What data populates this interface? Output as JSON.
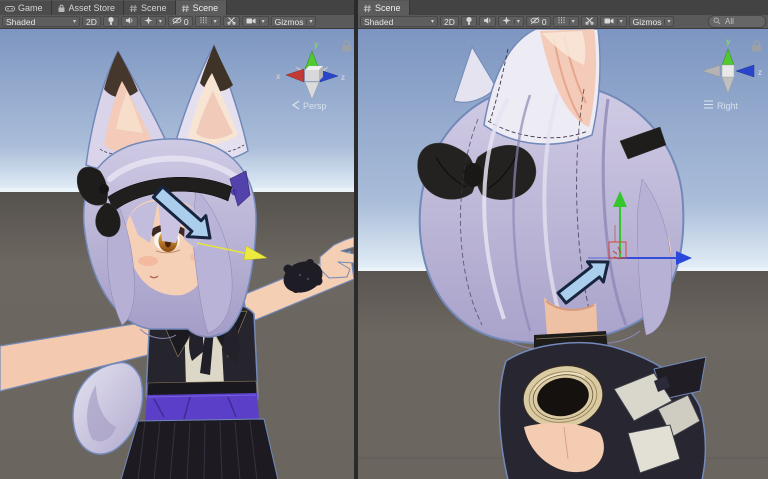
{
  "left_dock": {
    "tabs": [
      {
        "label": "Game",
        "icon": "game-icon"
      },
      {
        "label": "Asset Store",
        "icon": "asset-store-icon"
      },
      {
        "label": "Scene",
        "icon": "scene-icon"
      },
      {
        "label": "Scene",
        "icon": "scene-icon",
        "active": true
      }
    ]
  },
  "right_dock": {
    "tabs": [
      {
        "label": "Scene",
        "icon": "scene-icon",
        "active": true
      }
    ]
  },
  "toolbar": {
    "shading_mode": "Shaded",
    "two_d_label": "2D",
    "hidden_count": "0",
    "gizmos_label": "Gizmos",
    "search_placeholder": "All"
  },
  "left_view": {
    "axis_x": "x",
    "axis_y": "y",
    "axis_z": "z",
    "projection_label": "Persp"
  },
  "right_view": {
    "axis_y": "y",
    "axis_z": "z",
    "projection_label": "Right"
  },
  "colors": {
    "selection_outline": "#7289b9",
    "annotation_arrow_fill": "#abceec",
    "annotation_arrow_outline": "#17253f",
    "gaze_arrow": "#ece93e",
    "gizmo_axis_x": "#c23a34",
    "gizmo_axis_y": "#52c932",
    "gizmo_axis_z": "#2b44cc",
    "sky_top": "#7d96c1",
    "ground": "#6b6560",
    "hair": "#b9b2d6"
  }
}
